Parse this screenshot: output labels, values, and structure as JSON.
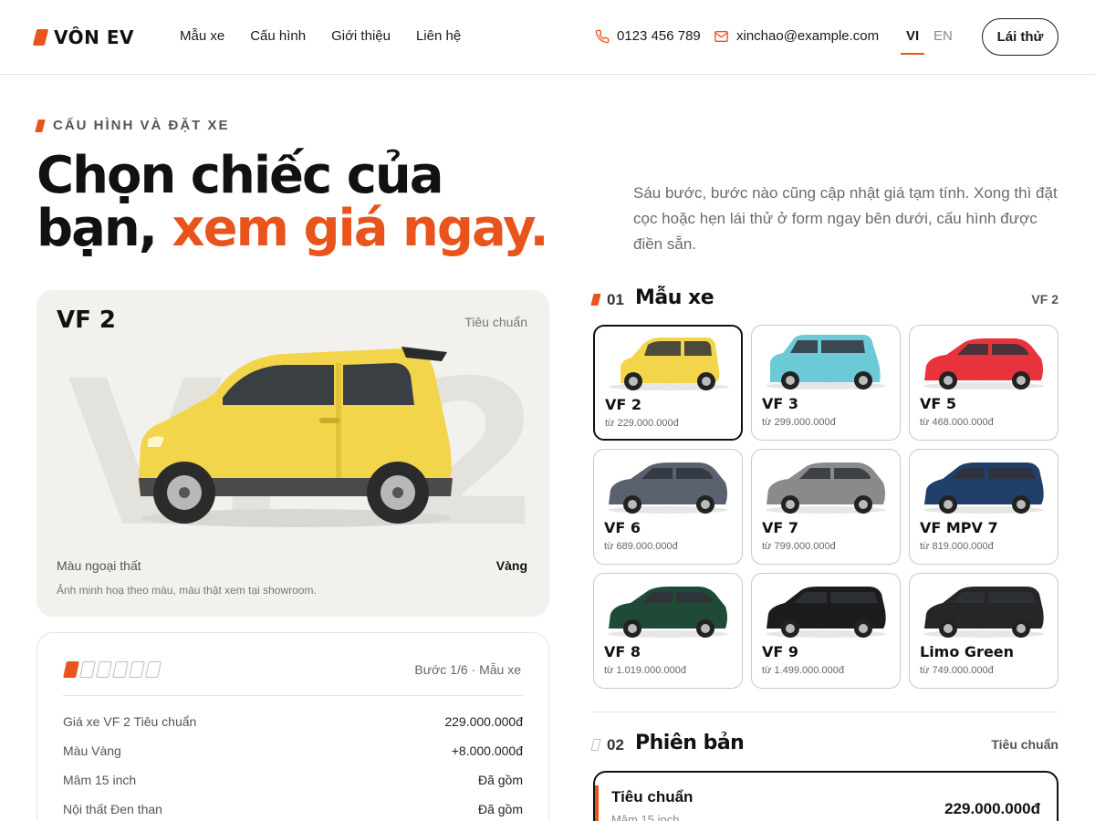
{
  "header": {
    "logo_text": "VÔN EV",
    "nav": [
      "Mẫu xe",
      "Cấu hình",
      "Giới thiệu",
      "Liên hệ"
    ],
    "phone": "0123 456 789",
    "email": "xinchao@example.com",
    "lang_vi": "VI",
    "lang_en": "EN",
    "cta": "Lái thử"
  },
  "hero": {
    "eyebrow": "CẤU HÌNH VÀ ĐẶT XE",
    "title_line1": "Chọn chiếc của",
    "title_line2_plain": "bạn,",
    "title_line2_accent": "xem giá ngay.",
    "description": "Sáu bước, bước nào cũng cập nhật giá tạm tính. Xong thì đặt cọc hoặc hẹn lái thử ở form ngay bên dưới, cấu hình được điền sẵn."
  },
  "preview": {
    "model": "VF 2",
    "trim": "Tiêu chuẩn",
    "watermark": "VF 2",
    "color_label": "Màu ngoại thất",
    "color_value": "Vàng",
    "note": "Ảnh minh hoạ theo màu, màu thật xem tại showroom."
  },
  "summary": {
    "step_label": "Bước 1/6 · Mẫu xe",
    "step_current": 1,
    "step_total": 6,
    "rows": [
      {
        "label": "Giá xe VF 2 Tiêu chuẩn",
        "value": "229.000.000đ"
      },
      {
        "label": "Màu Vàng",
        "value": "+8.000.000đ"
      },
      {
        "label": "Mâm 15 inch",
        "value": "Đã gồm"
      },
      {
        "label": "Nội thất Đen than",
        "value": "Đã gồm"
      }
    ]
  },
  "section_models": {
    "num": "01",
    "title": "Mẫu xe",
    "value": "VF 2",
    "models": [
      {
        "name": "VF 2",
        "price": "từ 229.000.000đ",
        "color": "#f2d54a",
        "type": "mini",
        "selected": true
      },
      {
        "name": "VF 3",
        "price": "từ 299.000.000đ",
        "color": "#6cc9d6",
        "type": "box",
        "selected": false
      },
      {
        "name": "VF 5",
        "price": "từ 468.000.000đ",
        "color": "#e8333d",
        "type": "suv",
        "selected": false
      },
      {
        "name": "VF 6",
        "price": "từ 689.000.000đ",
        "color": "#5a6270",
        "type": "suv",
        "selected": false
      },
      {
        "name": "VF 7",
        "price": "từ 799.000.000đ",
        "color": "#8a8a8a",
        "type": "suv",
        "selected": false
      },
      {
        "name": "VF MPV 7",
        "price": "từ 819.000.000đ",
        "color": "#213f6b",
        "type": "mpv",
        "selected": false
      },
      {
        "name": "VF 8",
        "price": "từ 1.019.000.000đ",
        "color": "#1e4a36",
        "type": "suv",
        "selected": false
      },
      {
        "name": "VF 9",
        "price": "từ 1.499.000.000đ",
        "color": "#1c1c1c",
        "type": "mpv",
        "selected": false
      },
      {
        "name": "Limo Green",
        "price": "từ 749.000.000đ",
        "color": "#262626",
        "type": "mpv",
        "selected": false
      }
    ]
  },
  "section_trim": {
    "num": "02",
    "title": "Phiên bản",
    "value": "Tiêu chuẩn",
    "selected_name": "Tiêu chuẩn",
    "selected_sub": "Mâm 15 inch",
    "selected_price": "229.000.000đ"
  },
  "colors": {
    "accent": "#e8541c",
    "selected_car": "#f2d54a"
  }
}
